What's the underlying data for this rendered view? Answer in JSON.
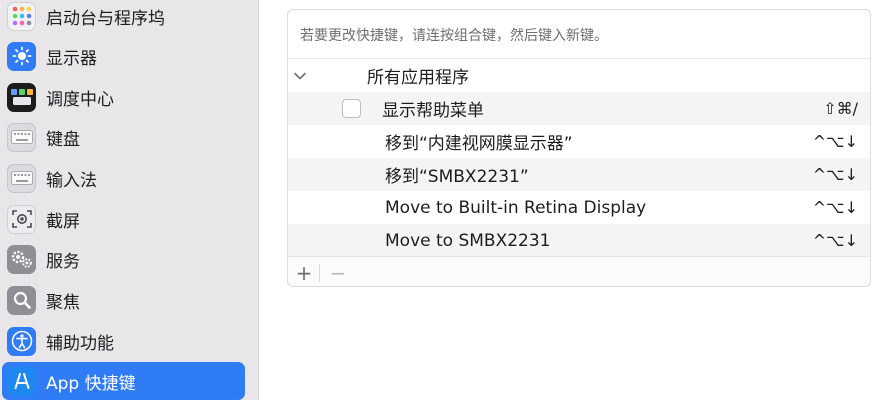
{
  "sidebar": {
    "items": [
      {
        "label": "启动台与程序坞",
        "icon": "launchpad-dock-icon",
        "active": false
      },
      {
        "label": "显示器",
        "icon": "display-sun-icon",
        "active": false
      },
      {
        "label": "调度中心",
        "icon": "mission-control-icon",
        "active": false
      },
      {
        "label": "键盘",
        "icon": "keyboard-icon",
        "active": false
      },
      {
        "label": "输入法",
        "icon": "input-source-keyboard-icon",
        "active": false
      },
      {
        "label": "截屏",
        "icon": "screenshot-icon",
        "active": false
      },
      {
        "label": "服务",
        "icon": "services-gears-icon",
        "active": false
      },
      {
        "label": "聚焦",
        "icon": "spotlight-magnifier-icon",
        "active": false
      },
      {
        "label": "辅助功能",
        "icon": "accessibility-icon",
        "active": false
      },
      {
        "label": "App 快捷键",
        "icon": "app-shortcuts-icon",
        "active": true
      }
    ]
  },
  "main": {
    "hint": "若要更改快捷键，请连按组合键，然后键入新键。",
    "group_label": "所有应用程序",
    "rows": [
      {
        "label": "显示帮助菜单",
        "keys": "⇧⌘/"
      },
      {
        "label": "移到“内建视网膜显示器”",
        "keys": "^⌥↓"
      },
      {
        "label": "移到“SMBX2231”",
        "keys": "^⌥↓"
      },
      {
        "label": "Move to Built-in Retina Display",
        "keys": "^⌥↓"
      },
      {
        "label": "Move to SMBX2231",
        "keys": "^⌥↓"
      }
    ],
    "footer": {
      "add": "+",
      "remove": "−"
    }
  },
  "colors": {
    "accent": "#2f7cf6",
    "sidebar_bg": "#e9e6ea"
  }
}
